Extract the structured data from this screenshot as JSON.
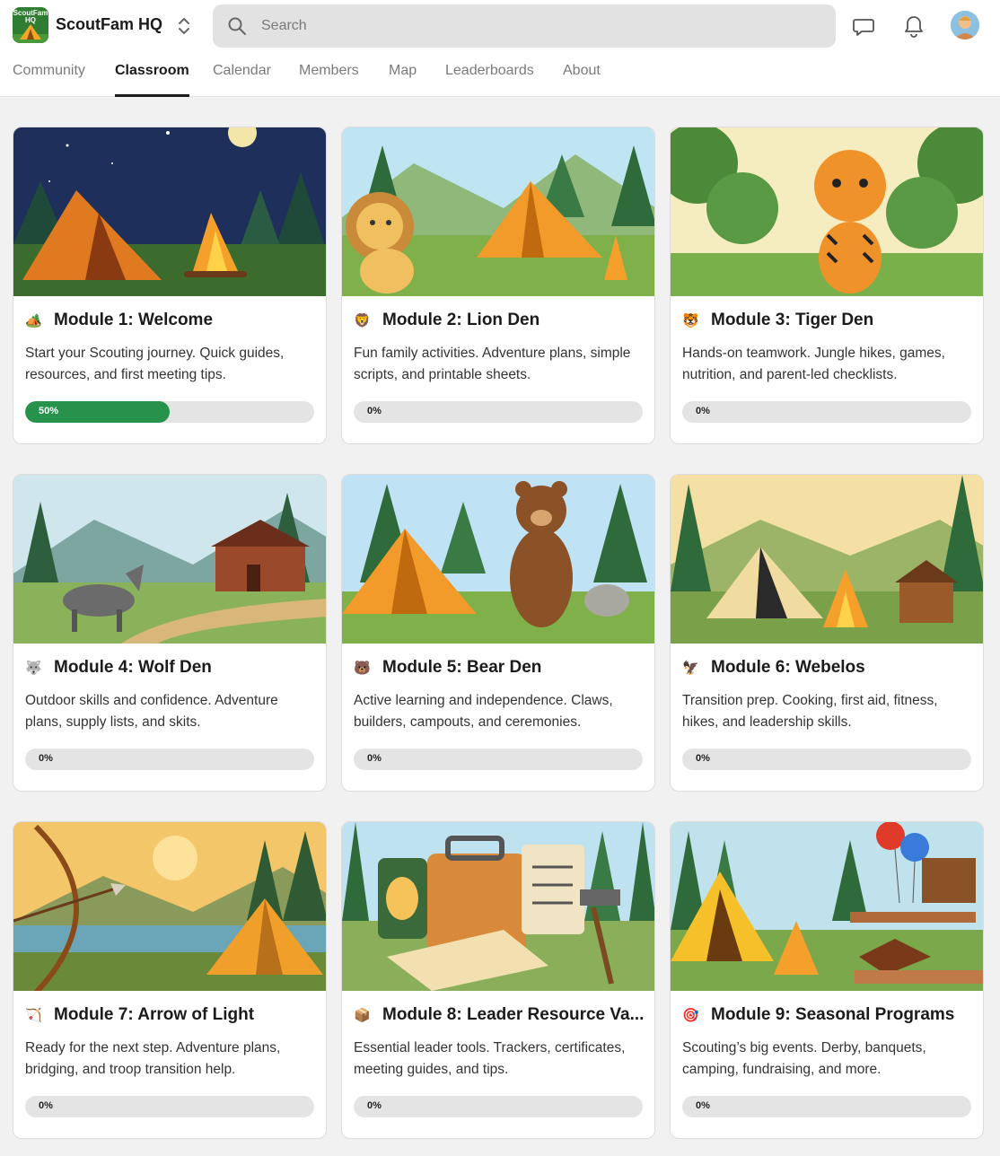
{
  "app": {
    "logo_text": "ScoutFam HQ",
    "name": "ScoutFam HQ"
  },
  "search": {
    "placeholder": "Search"
  },
  "tabs": [
    {
      "label": "Community"
    },
    {
      "label": "Classroom",
      "active": true
    },
    {
      "label": "Calendar"
    },
    {
      "label": "Members"
    },
    {
      "label": "Map"
    },
    {
      "label": "Leaderboards"
    },
    {
      "label": "About"
    }
  ],
  "modules": [
    {
      "emoji": "🏕️",
      "title": "Module 1: Welcome",
      "description": "Start your Scouting journey. Quick guides, resources, and first meeting tips.",
      "progress": 50,
      "progress_label": "50%"
    },
    {
      "emoji": "🦁",
      "title": "Module 2: Lion Den",
      "description": "Fun family activities. Adventure plans, simple scripts, and printable sheets.",
      "progress": 0,
      "progress_label": "0%"
    },
    {
      "emoji": "🐯",
      "title": "Module 3: Tiger Den",
      "description": "Hands-on teamwork. Jungle hikes, games, nutrition, and parent-led checklists.",
      "progress": 0,
      "progress_label": "0%"
    },
    {
      "emoji": "🐺",
      "title": "Module 4: Wolf Den",
      "description": "Outdoor skills and confidence. Adventure plans, supply lists, and skits.",
      "progress": 0,
      "progress_label": "0%"
    },
    {
      "emoji": "🐻",
      "title": "Module 5: Bear Den",
      "description": "Active learning and independence. Claws, builders, campouts, and ceremonies.",
      "progress": 0,
      "progress_label": "0%"
    },
    {
      "emoji": "🦅",
      "title": "Module 6: Webelos",
      "description": "Transition prep. Cooking, first aid, fitness, hikes, and leadership skills.",
      "progress": 0,
      "progress_label": "0%"
    },
    {
      "emoji": "🏹",
      "title": "Module 7: Arrow of Light",
      "description": "Ready for the next step. Adventure plans, bridging, and troop transition help.",
      "progress": 0,
      "progress_label": "0%"
    },
    {
      "emoji": "📦",
      "title": "Module 8: Leader Resource Va...",
      "description": "Essential leader tools. Trackers, certificates, meeting guides, and tips.",
      "progress": 0,
      "progress_label": "0%"
    },
    {
      "emoji": "🎯",
      "title": "Module 9: Seasonal Programs",
      "description": "Scouting’s big events. Derby, banquets, camping, fundraising, and more.",
      "progress": 0,
      "progress_label": "0%"
    }
  ],
  "colors": {
    "progress_fill": "#27924b",
    "progress_track": "#e4e4e4",
    "accent": "#1b1b1b"
  }
}
